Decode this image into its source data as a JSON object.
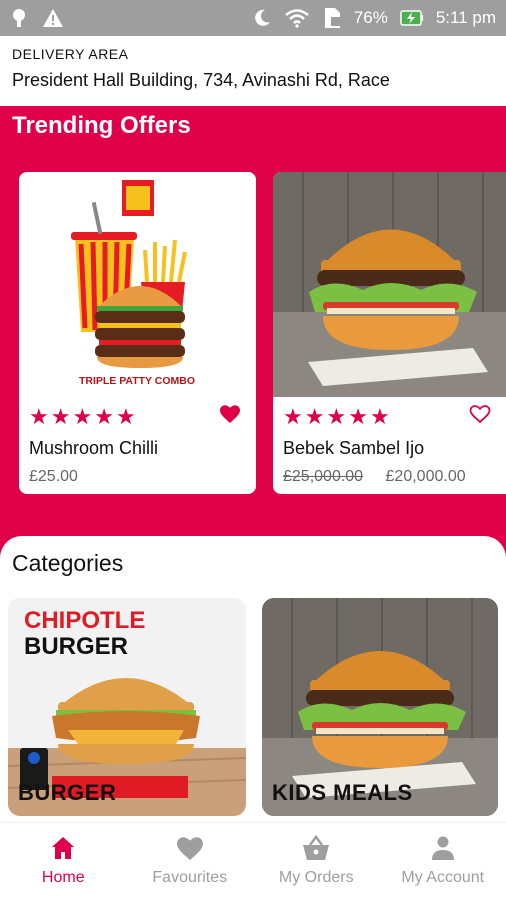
{
  "status_bar": {
    "battery": "76%",
    "time": "5:11 pm"
  },
  "delivery": {
    "label": "DELIVERY AREA",
    "address": "President Hall Building, 734, Avinashi Rd, Race"
  },
  "trending": {
    "title": "Trending Offers",
    "items": [
      {
        "name": "Mushroom Chilli",
        "price": "£25.00",
        "old_price": "",
        "rating": 5,
        "favourite": true,
        "image_caption": "TRIPLE PATTY COMBO"
      },
      {
        "name": "Bebek Sambel Ijo",
        "price": "£20,000.00",
        "old_price": "£25,000.00",
        "rating": 5,
        "favourite": false
      }
    ]
  },
  "categories": {
    "title": "Categories",
    "items": [
      {
        "label": "BURGER",
        "banner_line1": "CHIPOTLE",
        "banner_line2": "BURGER"
      },
      {
        "label": "KIDS MEALS"
      }
    ]
  },
  "nav": {
    "items": [
      {
        "label": "Home",
        "active": true
      },
      {
        "label": "Favourites",
        "active": false
      },
      {
        "label": "My Orders",
        "active": false
      },
      {
        "label": "My Account",
        "active": false
      }
    ]
  },
  "colors": {
    "accent": "#e0004a",
    "status_bar": "#9e9e9e",
    "muted": "#9e9e9e"
  }
}
